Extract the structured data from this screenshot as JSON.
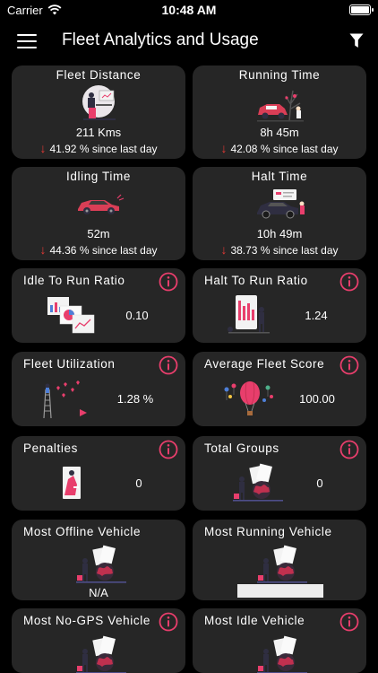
{
  "status": {
    "carrier": "Carrier",
    "time": "10:48 AM"
  },
  "header": {
    "title": "Fleet Analytics and Usage"
  },
  "icons": {
    "menu": "hamburger-menu-icon",
    "filter": "filter-icon",
    "info": "info-icon",
    "trend_down": "arrow-down-icon"
  },
  "colors": {
    "background": "#000000",
    "card": "#262626",
    "accent": "#e83e6c",
    "down_arrow": "#e53935"
  },
  "cards": {
    "fleet_distance": {
      "title": "Fleet Distance",
      "value": "211 Kms",
      "change": "41.92 % since last day"
    },
    "running_time": {
      "title": "Running Time",
      "value": "8h 45m",
      "change": "42.08 % since last day"
    },
    "idling_time": {
      "title": "Idling Time",
      "value": "52m",
      "change": "44.36 % since last day"
    },
    "halt_time": {
      "title": "Halt Time",
      "value": "10h 49m",
      "change": "38.73 % since last day"
    },
    "idle_run_ratio": {
      "title": "Idle To Run Ratio",
      "value": "0.10"
    },
    "halt_run_ratio": {
      "title": "Halt To Run Ratio",
      "value": "1.24"
    },
    "fleet_utilization": {
      "title": "Fleet Utilization",
      "value": "1.28 %"
    },
    "avg_fleet_score": {
      "title": "Average Fleet Score",
      "value": "100.00"
    },
    "penalties": {
      "title": "Penalties",
      "value": "0"
    },
    "total_groups": {
      "title": "Total Groups",
      "value": "0"
    },
    "most_offline": {
      "title": "Most Offline Vehicle",
      "value": "N/A"
    },
    "most_running": {
      "title": "Most Running Vehicle"
    },
    "most_nogps": {
      "title": "Most No-GPS Vehicle"
    },
    "most_idle": {
      "title": "Most Idle Vehicle"
    }
  }
}
